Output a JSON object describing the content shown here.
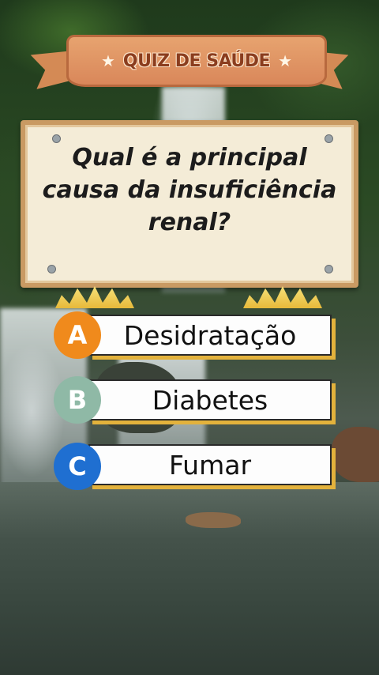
{
  "banner": {
    "title": "QUIZ DE SAÚDE",
    "star_left": "★",
    "star_right": "★"
  },
  "question": {
    "text": "Qual é a principal causa da insuficiência renal?"
  },
  "options": [
    {
      "letter": "A",
      "label": "Desidratação",
      "color": "#f08a1c"
    },
    {
      "letter": "B",
      "label": "Diabetes",
      "color": "#8fb9a6"
    },
    {
      "letter": "C",
      "label": "Fumar",
      "color": "#1f6fd1"
    }
  ],
  "colors": {
    "banner": "#d9875a",
    "board": "#f4ecd7",
    "option_shadow": "#e3b23c"
  }
}
